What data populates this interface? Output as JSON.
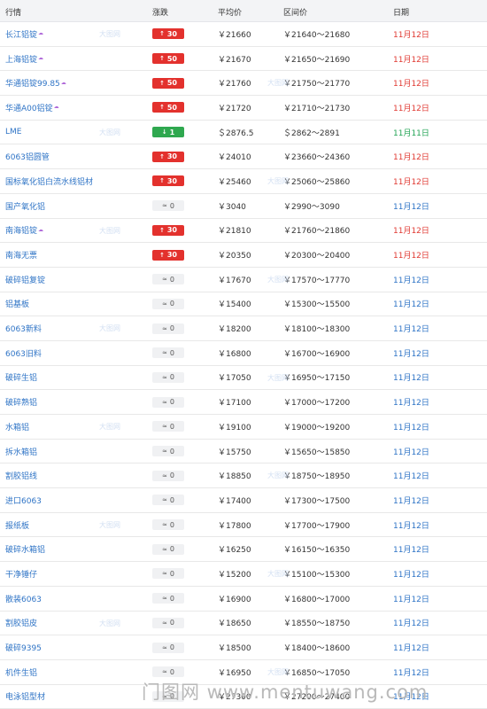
{
  "header": {
    "col_name": "行情",
    "col_change": "涨跌",
    "col_avg": "平均价",
    "col_range": "区间价",
    "col_date": "日期"
  },
  "small_watermark": "大图网",
  "rows": [
    {
      "name": "长江铝锭",
      "sup": true,
      "dir": "up",
      "change": "30",
      "avg": "￥21660",
      "range": "￥21640～21680",
      "date": "11月12日"
    },
    {
      "name": "上海铝锭",
      "sup": true,
      "dir": "up",
      "change": "50",
      "avg": "￥21670",
      "range": "￥21650～21690",
      "date": "11月12日"
    },
    {
      "name": "华通铝锭99.85",
      "sup": true,
      "dir": "up",
      "change": "50",
      "avg": "￥21760",
      "range": "￥21750～21770",
      "date": "11月12日"
    },
    {
      "name": "华通A00铝锭",
      "sup": true,
      "dir": "up",
      "change": "50",
      "avg": "￥21720",
      "range": "￥21710～21730",
      "date": "11月12日"
    },
    {
      "name": "LME",
      "sup": false,
      "dir": "down",
      "change": "1",
      "avg": "＄2876.5",
      "range": "＄2862～2891",
      "date": "11月11日"
    },
    {
      "name": "6063铝圆管",
      "sup": false,
      "dir": "up",
      "change": "30",
      "avg": "￥24010",
      "range": "￥23660～24360",
      "date": "11月12日"
    },
    {
      "name": "国标氧化铝白流水线铝材",
      "sup": false,
      "dir": "up",
      "change": "30",
      "avg": "￥25460",
      "range": "￥25060～25860",
      "date": "11月12日"
    },
    {
      "name": "国产氧化铝",
      "sup": false,
      "dir": "flat",
      "change": "0",
      "avg": "￥3040",
      "range": "￥2990～3090",
      "date": "11月12日"
    },
    {
      "name": "南海铝锭",
      "sup": true,
      "dir": "up",
      "change": "30",
      "avg": "￥21810",
      "range": "￥21760～21860",
      "date": "11月12日"
    },
    {
      "name": "南海无票",
      "sup": false,
      "dir": "up",
      "change": "30",
      "avg": "￥20350",
      "range": "￥20300～20400",
      "date": "11月12日"
    },
    {
      "name": "破碎铝复锭",
      "sup": false,
      "dir": "flat",
      "change": "0",
      "avg": "￥17670",
      "range": "￥17570～17770",
      "date": "11月12日"
    },
    {
      "name": "铝基板",
      "sup": false,
      "dir": "flat",
      "change": "0",
      "avg": "￥15400",
      "range": "￥15300～15500",
      "date": "11月12日"
    },
    {
      "name": "6063新料",
      "sup": false,
      "dir": "flat",
      "change": "0",
      "avg": "￥18200",
      "range": "￥18100～18300",
      "date": "11月12日"
    },
    {
      "name": "6063旧料",
      "sup": false,
      "dir": "flat",
      "change": "0",
      "avg": "￥16800",
      "range": "￥16700～16900",
      "date": "11月12日"
    },
    {
      "name": "破碎生铝",
      "sup": false,
      "dir": "flat",
      "change": "0",
      "avg": "￥17050",
      "range": "￥16950～17150",
      "date": "11月12日"
    },
    {
      "name": "破碎熟铝",
      "sup": false,
      "dir": "flat",
      "change": "0",
      "avg": "￥17100",
      "range": "￥17000～17200",
      "date": "11月12日"
    },
    {
      "name": "水箱铝",
      "sup": false,
      "dir": "flat",
      "change": "0",
      "avg": "￥19100",
      "range": "￥19000～19200",
      "date": "11月12日"
    },
    {
      "name": "拆水箱铝",
      "sup": false,
      "dir": "flat",
      "change": "0",
      "avg": "￥15750",
      "range": "￥15650～15850",
      "date": "11月12日"
    },
    {
      "name": "割胶铝线",
      "sup": false,
      "dir": "flat",
      "change": "0",
      "avg": "￥18850",
      "range": "￥18750～18950",
      "date": "11月12日"
    },
    {
      "name": "进口6063",
      "sup": false,
      "dir": "flat",
      "change": "0",
      "avg": "￥17400",
      "range": "￥17300～17500",
      "date": "11月12日"
    },
    {
      "name": "报纸板",
      "sup": false,
      "dir": "flat",
      "change": "0",
      "avg": "￥17800",
      "range": "￥17700～17900",
      "date": "11月12日"
    },
    {
      "name": "破碎水箱铝",
      "sup": false,
      "dir": "flat",
      "change": "0",
      "avg": "￥16250",
      "range": "￥16150～16350",
      "date": "11月12日"
    },
    {
      "name": "干净锤仔",
      "sup": false,
      "dir": "flat",
      "change": "0",
      "avg": "￥15200",
      "range": "￥15100～15300",
      "date": "11月12日"
    },
    {
      "name": "散装6063",
      "sup": false,
      "dir": "flat",
      "change": "0",
      "avg": "￥16900",
      "range": "￥16800～17000",
      "date": "11月12日"
    },
    {
      "name": "割胶铝皮",
      "sup": false,
      "dir": "flat",
      "change": "0",
      "avg": "￥18650",
      "range": "￥18550～18750",
      "date": "11月12日"
    },
    {
      "name": "破碎9395",
      "sup": false,
      "dir": "flat",
      "change": "0",
      "avg": "￥18500",
      "range": "￥18400～18600",
      "date": "11月12日"
    },
    {
      "name": "机件生铝",
      "sup": false,
      "dir": "flat",
      "change": "0",
      "avg": "￥16950",
      "range": "￥16850～17050",
      "date": "11月12日"
    },
    {
      "name": "电泳铝型材",
      "sup": false,
      "dir": "flat",
      "change": "0",
      "avg": "￥27300",
      "range": "￥27200～27400",
      "date": "11月12日"
    }
  ],
  "arrows": {
    "up": "↑",
    "down": "↓",
    "flat": "≈"
  },
  "watermark": "门图网 www.mentuwang.com"
}
